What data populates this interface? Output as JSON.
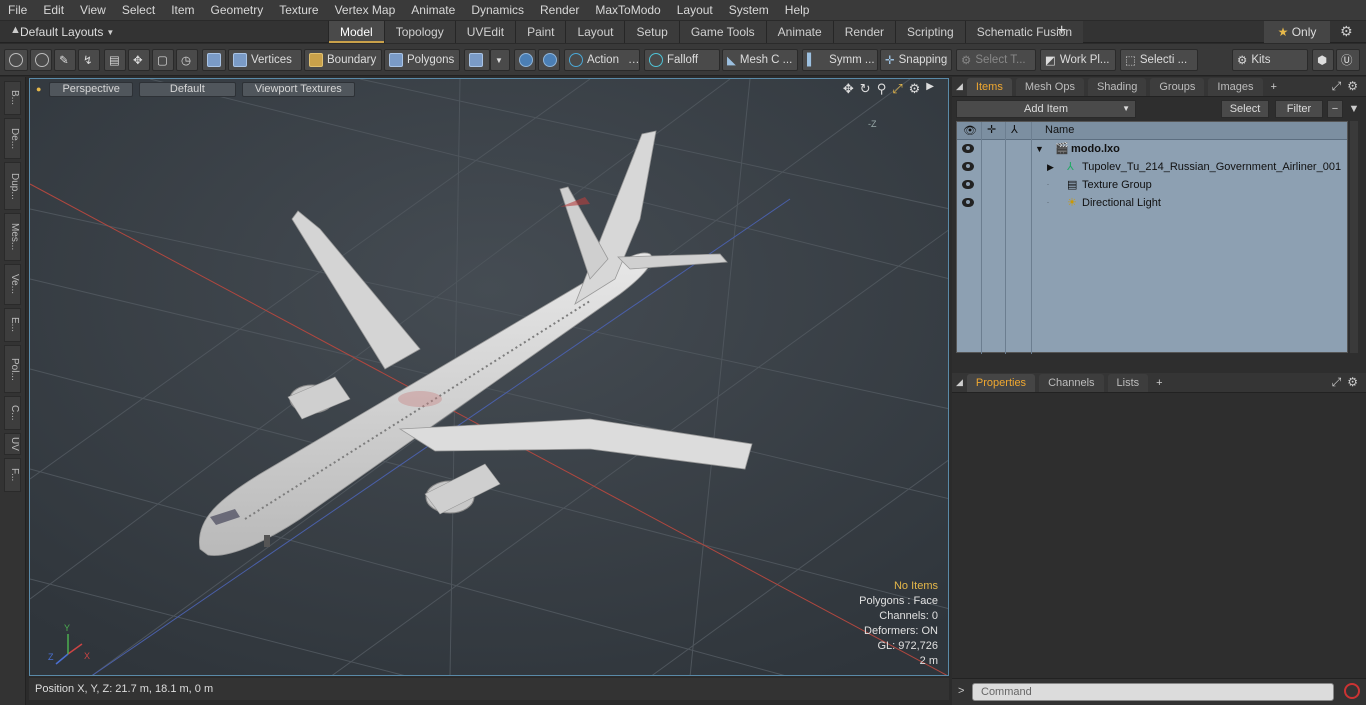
{
  "menu": [
    "File",
    "Edit",
    "View",
    "Select",
    "Item",
    "Geometry",
    "Texture",
    "Vertex Map",
    "Animate",
    "Dynamics",
    "Render",
    "MaxToModo",
    "Layout",
    "System",
    "Help"
  ],
  "layouts_label": "Default Layouts",
  "tabs": [
    "Model",
    "Topology",
    "UVEdit",
    "Paint",
    "Layout",
    "Setup",
    "Game Tools",
    "Animate",
    "Render",
    "Scripting",
    "Schematic Fusion"
  ],
  "only_label": "Only",
  "toolbar": {
    "vertices": "Vertices",
    "boundary": "Boundary",
    "polygons": "Polygons",
    "action": "Action",
    "falloff": "Falloff",
    "mesh": "Mesh C ...",
    "symm": "Symm ...",
    "snapping": "Snapping",
    "select_t": "Select T...",
    "workpl": "Work Pl...",
    "selecti": "Selecti ...",
    "kits": "Kits"
  },
  "left_tabs": [
    "B...",
    "De...",
    "Dup...",
    "Mes...",
    "Ve...",
    "E...",
    "Pol...",
    "C...",
    "UV",
    "F..."
  ],
  "viewport": {
    "perspective": "Perspective",
    "default": "Default",
    "textures": "Viewport Textures",
    "stats": {
      "no_items": "No Items",
      "polygons": "Polygons : Face",
      "channels": "Channels: 0",
      "deformers": "Deformers: ON",
      "gl": "GL: 972,726",
      "scale": "2 m"
    },
    "axis": {
      "x": "X",
      "y": "Y",
      "z": "Z"
    },
    "minus_z": "-Z"
  },
  "status": "Position X, Y, Z:   21.7 m, 18.1 m, 0 m",
  "items_panel": {
    "tabs": [
      "Items",
      "Mesh Ops",
      "Shading",
      "Groups",
      "Images"
    ],
    "add_item": "Add Item",
    "select": "Select",
    "filter": "Filter",
    "column_name": "Name",
    "rows": [
      {
        "label": "modo.lxo",
        "bold": true
      },
      {
        "label": "Tupolev_Tu_214_Russian_Government_Airliner_001"
      },
      {
        "label": "Texture Group"
      },
      {
        "label": "Directional Light"
      }
    ]
  },
  "props_panel": {
    "tabs": [
      "Properties",
      "Channels",
      "Lists"
    ]
  },
  "command_placeholder": "Command",
  "colors": {
    "accent": "#f0a830",
    "tree_bg": "#8da0b2",
    "viewport_bg": "#3a4046"
  }
}
